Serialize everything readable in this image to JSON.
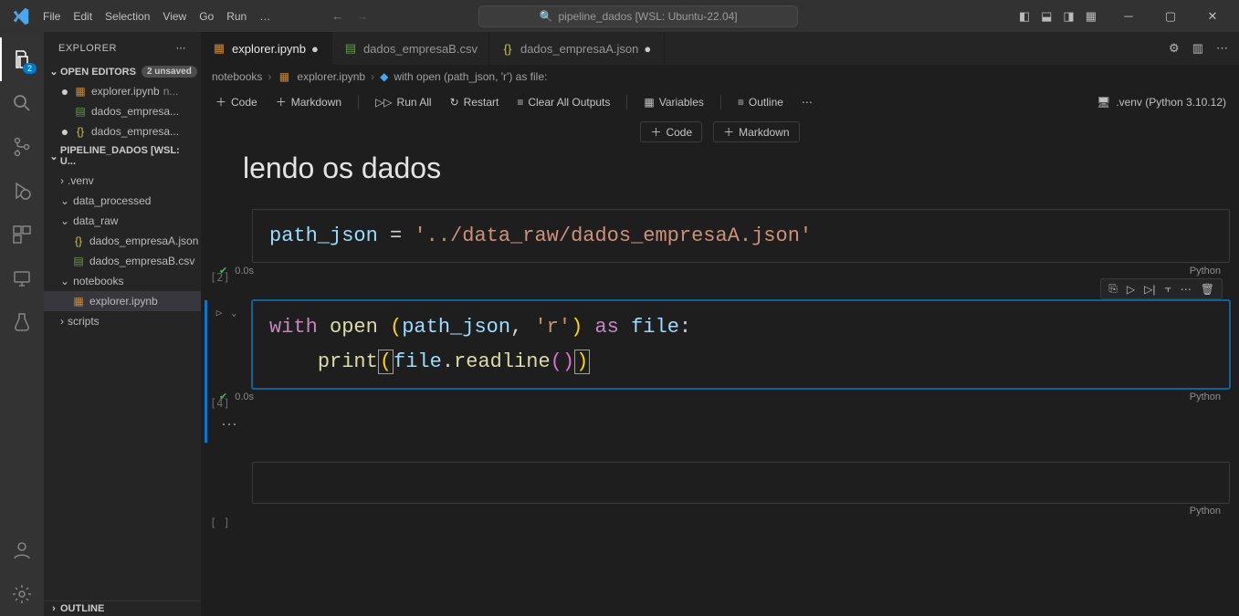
{
  "titlebar": {
    "menus": [
      "File",
      "Edit",
      "Selection",
      "View",
      "Go",
      "Run",
      "…"
    ],
    "command_center": "pipeline_dados [WSL: Ubuntu-22.04]"
  },
  "activitybar": {
    "badge": "2"
  },
  "sidebar": {
    "title": "EXPLORER",
    "open_editors_label": "OPEN EDITORS",
    "unsaved_badge": "2 unsaved",
    "open_editors": [
      {
        "name": "explorer.ipynb",
        "hint": "n...",
        "icon": "ipynb",
        "dirty": true
      },
      {
        "name": "dados_empresa...",
        "icon": "csv",
        "dirty": false
      },
      {
        "name": "dados_empresa...",
        "icon": "json",
        "dirty": true
      }
    ],
    "workspace_label": "PIPELINE_DADOS [WSL: U...",
    "tree": [
      {
        "type": "folder",
        "name": ".venv",
        "open": false,
        "depth": 1
      },
      {
        "type": "folder",
        "name": "data_processed",
        "open": true,
        "depth": 1
      },
      {
        "type": "folder",
        "name": "data_raw",
        "open": true,
        "depth": 1
      },
      {
        "type": "file",
        "name": "dados_empresaA.json",
        "icon": "json",
        "depth": 2
      },
      {
        "type": "file",
        "name": "dados_empresaB.csv",
        "icon": "csv",
        "depth": 2
      },
      {
        "type": "folder",
        "name": "notebooks",
        "open": true,
        "depth": 1
      },
      {
        "type": "file",
        "name": "explorer.ipynb",
        "icon": "ipynb",
        "depth": 2,
        "selected": true
      },
      {
        "type": "folder",
        "name": "scripts",
        "open": false,
        "depth": 1
      }
    ],
    "outline_label": "OUTLINE"
  },
  "tabs": [
    {
      "label": "explorer.ipynb",
      "icon": "ipynb",
      "dirty": true,
      "active": true
    },
    {
      "label": "dados_empresaB.csv",
      "icon": "csv",
      "dirty": false,
      "active": false
    },
    {
      "label": "dados_empresaA.json",
      "icon": "json",
      "dirty": true,
      "active": false
    }
  ],
  "breadcrumbs": {
    "parts": [
      "notebooks",
      "explorer.ipynb",
      "with open (path_json, 'r') as file:"
    ]
  },
  "nb_toolbar": {
    "code": "Code",
    "markdown": "Markdown",
    "run_all": "Run All",
    "restart": "Restart",
    "clear": "Clear All Outputs",
    "variables": "Variables",
    "outline": "Outline",
    "kernel": ".venv (Python 3.10.12)"
  },
  "insert": {
    "code": "Code",
    "markdown": "Markdown"
  },
  "cells": {
    "md_heading": "lendo os dados",
    "c1_exec": "[2]",
    "c1_time": "0.0s",
    "c1_lang": "Python",
    "c1_code": {
      "var": "path_json",
      "op": " = ",
      "str": "'../data_raw/dados_empresaA.json'"
    },
    "c2_exec": "[4]",
    "c2_time": "0.0s",
    "c2_lang": "Python",
    "c2_line1": {
      "kw1": "with",
      "sp": " ",
      "fn": "open",
      "sp2": " ",
      "p1": "(",
      "var": "path_json",
      "comma": ", ",
      "str": "'r'",
      "p2": ")",
      "sp3": " ",
      "kw2": "as",
      "sp4": " ",
      "var2": "file",
      "colon": ":"
    },
    "c2_line2": {
      "indent": "    ",
      "fn": "print",
      "p1": "(",
      "var": "file",
      "dot": ".",
      "m": "readline",
      "p2a": "(",
      "p2b": ")",
      "p3": ")"
    },
    "c3_exec": "[ ]",
    "c3_lang": "Python"
  }
}
